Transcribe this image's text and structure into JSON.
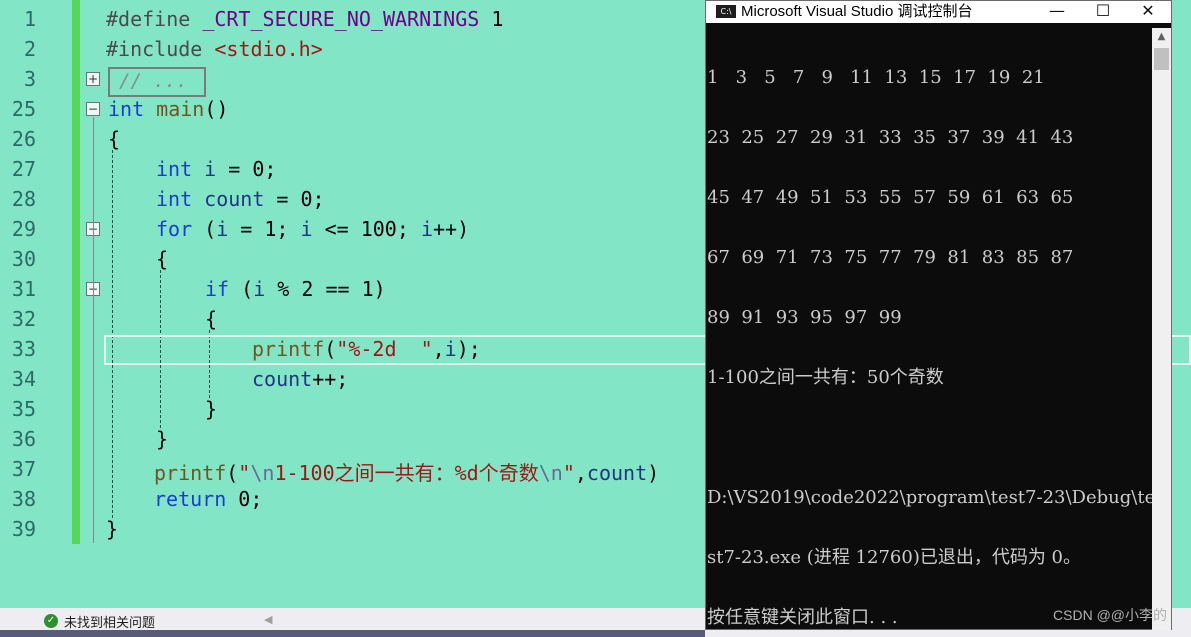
{
  "editor": {
    "line_numbers": [
      "1",
      "2",
      "3",
      "25",
      "26",
      "27",
      "28",
      "29",
      "30",
      "31",
      "32",
      "33",
      "34",
      "35",
      "36",
      "37",
      "38",
      "39"
    ],
    "collapsed_label": "// ...",
    "fold_glyph": "+",
    "unfold_glyph": "−",
    "code": {
      "l1_a": "#define ",
      "l1_b": "_CRT_SECURE_NO_WARNINGS",
      "l1_c": " 1",
      "l2_a": "#include ",
      "l2_b": "<stdio.h>",
      "l25_a": "int",
      "l25_b": " main",
      "l25_c": "()",
      "l26": "{",
      "l27_a": "int",
      "l27_b": " i",
      "l27_c": " = 0;",
      "l28_a": "int",
      "l28_b": " count",
      "l28_c": " = 0;",
      "l29_a": "for",
      "l29_b": " (",
      "l29_c": "i",
      "l29_d": " = 1; ",
      "l29_e": "i",
      "l29_f": " <= 100; ",
      "l29_g": "i",
      "l29_h": "++)",
      "l30": "{",
      "l31_a": "if",
      "l31_b": " (",
      "l31_c": "i",
      "l31_d": " % 2 == 1)",
      "l32": "{",
      "l33_a": "printf",
      "l33_b": "(",
      "l33_c": "\"%-2d  \"",
      "l33_d": ",",
      "l33_e": "i",
      "l33_f": ");",
      "l34_a": "count",
      "l34_b": "++;",
      "l35": "}",
      "l36": "}",
      "l37_a": "printf",
      "l37_b": "(",
      "l37_c": "\"",
      "l37_d": "\\n",
      "l37_e": "1-100之间一共有：%d个奇数",
      "l37_f": "\\n",
      "l37_g": "\"",
      "l37_h": ",",
      "l37_i": "count",
      "l37_j": ")",
      "l38_a": "return",
      "l38_b": " 0;",
      "l39": "}"
    }
  },
  "console": {
    "title": "Microsoft Visual Studio 调试控制台",
    "icon_label": "C:\\",
    "minimize_glyph": "—",
    "maximize_glyph": "☐",
    "close_glyph": "✕",
    "scroll_up_glyph": "▲",
    "lines": [
      "1   3   5   7   9   11  13  15  17  19  21",
      "23  25  27  29  31  33  35  37  39  41  43",
      "45  47  49  51  53  55  57  59  61  63  65",
      "67  69  71  73  75  77  79  81  83  85  87",
      "89  91  93  95  97  99",
      "1-100之间一共有：50个奇数",
      "",
      "D:\\VS2019\\code2022\\program\\test7-23\\Debug\\te",
      "st7-23.exe (进程 12760)已退出，代码为 0。",
      "按任意键关闭此窗口. . ."
    ],
    "watermark": "CSDN @@小李的"
  },
  "statusbar": {
    "ok_icon": "✓",
    "text": "未找到相关问题",
    "arrow": "◀"
  },
  "colors": {
    "editor_bg": "#82e6c6",
    "keyword": "#1a3cd0",
    "macro": "#6f008a",
    "string": "#a31515",
    "console_bg": "#0c0c0c",
    "console_fg": "#cccccc"
  }
}
